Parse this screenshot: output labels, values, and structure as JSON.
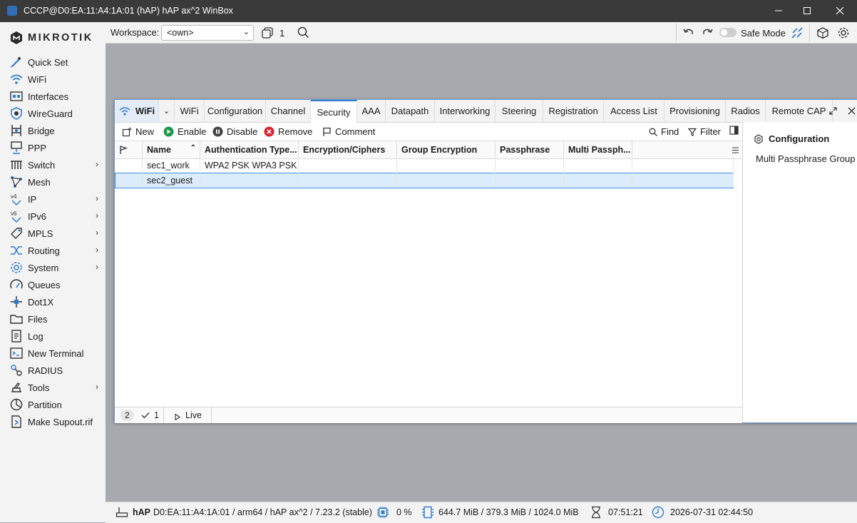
{
  "titlebar": {
    "title": "CCCP@D0:EA:11:A4:1A:01 (hAP) hAP ax^2 WinBox"
  },
  "sidebar": {
    "logo": "MIKROTIK",
    "items": [
      {
        "label": "Quick Set",
        "icon": "wand-icon",
        "arrow": false
      },
      {
        "label": "WiFi",
        "icon": "wifi-icon",
        "arrow": false
      },
      {
        "label": "Interfaces",
        "icon": "interfaces-icon",
        "arrow": false
      },
      {
        "label": "WireGuard",
        "icon": "wireguard-icon",
        "arrow": false
      },
      {
        "label": "Bridge",
        "icon": "bridge-icon",
        "arrow": false
      },
      {
        "label": "PPP",
        "icon": "ppp-icon",
        "arrow": false
      },
      {
        "label": "Switch",
        "icon": "switch-icon",
        "arrow": true
      },
      {
        "label": "Mesh",
        "icon": "mesh-icon",
        "arrow": false
      },
      {
        "label": "IP",
        "icon": "ip-icon",
        "arrow": true
      },
      {
        "label": "IPv6",
        "icon": "ipv6-icon",
        "arrow": true
      },
      {
        "label": "MPLS",
        "icon": "mpls-icon",
        "arrow": true
      },
      {
        "label": "Routing",
        "icon": "routing-icon",
        "arrow": true
      },
      {
        "label": "System",
        "icon": "system-gear-icon",
        "arrow": true
      },
      {
        "label": "Queues",
        "icon": "queues-icon",
        "arrow": false
      },
      {
        "label": "Dot1X",
        "icon": "dot1x-icon",
        "arrow": false
      },
      {
        "label": "Files",
        "icon": "files-icon",
        "arrow": false
      },
      {
        "label": "Log",
        "icon": "log-icon",
        "arrow": false
      },
      {
        "label": "New Terminal",
        "icon": "terminal-icon",
        "arrow": false
      },
      {
        "label": "RADIUS",
        "icon": "radius-icon",
        "arrow": false
      },
      {
        "label": "Tools",
        "icon": "tools-icon",
        "arrow": true
      },
      {
        "label": "Partition",
        "icon": "partition-icon",
        "arrow": false
      },
      {
        "label": "Make Supout.rif",
        "icon": "supout-icon",
        "arrow": false
      }
    ]
  },
  "toolbar": {
    "workspace_label": "Workspace:",
    "workspace_value": "<own>",
    "window_count": "1",
    "safe_mode_label": "Safe Mode"
  },
  "window": {
    "main_tab": "WiFi",
    "tabs": [
      "WiFi",
      "Configuration",
      "Channel",
      "Security",
      "AAA",
      "Datapath",
      "Interworking",
      "Steering",
      "Registration",
      "Access List",
      "Provisioning",
      "Radios",
      "Remote CAP"
    ],
    "active_tab": "Security",
    "actions": {
      "new": "New",
      "enable": "Enable",
      "disable": "Disable",
      "remove": "Remove",
      "comment": "Comment",
      "find": "Find",
      "filter": "Filter"
    },
    "columns": [
      "Name",
      "Authentication Type...",
      "Encryption/Ciphers",
      "Group Encryption",
      "Passphrase",
      "Multi Passph..."
    ],
    "rows": [
      {
        "name": "sec1_work",
        "auth": "WPA2 PSK WPA3 PSK",
        "enc": "",
        "group": "",
        "pass": "",
        "multi": ""
      },
      {
        "name": "sec2_guest",
        "auth": "",
        "enc": "",
        "group": "",
        "pass": "",
        "multi": ""
      }
    ],
    "side_panel": {
      "title": "Configuration",
      "item": "Multi Passphrase Group"
    },
    "status": {
      "count": "2",
      "checked": "1",
      "live": "Live"
    }
  },
  "statusbar": {
    "model": "hAP",
    "info": "D0:EA:11:A4:1A:01 / arm64 / hAP ax^2 / 7.23.2 (stable)",
    "cpu": "0 %",
    "memory": "644.7 MiB / 379.3 MiB / 1024.0 MiB",
    "uptime": "07:51:21",
    "datetime": "2026-07-31 02:44:50"
  },
  "colors": {
    "accent": "#2e7bd1",
    "enable_green": "#1f9a4a",
    "remove_red": "#d9232d"
  }
}
